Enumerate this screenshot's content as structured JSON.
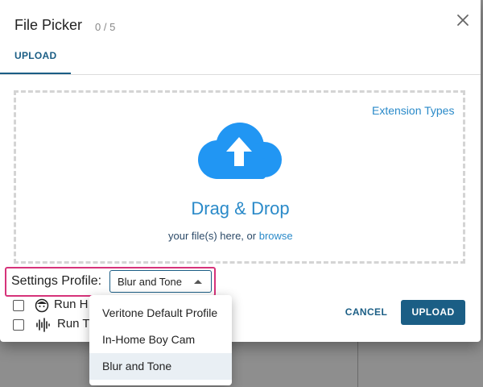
{
  "dialog": {
    "title": "File Picker",
    "count": "0 / 5",
    "close_icon": "close-icon"
  },
  "tabs": [
    {
      "label": "UPLOAD",
      "active": true
    }
  ],
  "dropzone": {
    "extension_link": "Extension Types",
    "icon": "cloud-upload-icon",
    "title": "Drag & Drop",
    "subtitle_prefix": "your file(s) here, or",
    "browse_link": "browse"
  },
  "settings": {
    "label": "Settings Profile:",
    "selected": "Blur and Tone",
    "options": [
      "Veritone Default Profile",
      "In-Home Boy Cam",
      "Blur and Tone"
    ]
  },
  "rows": [
    {
      "label": "Run H",
      "icon": "face-icon",
      "checked": false
    },
    {
      "label": "Run T",
      "icon": "audio-waveform-icon",
      "checked": false
    }
  ],
  "actions": {
    "cancel": "CANCEL",
    "upload": "UPLOAD"
  },
  "colors": {
    "accent": "#1b5e85",
    "link": "#2a8ac9",
    "cloud": "#2196f3",
    "highlight": "#d6337a"
  }
}
